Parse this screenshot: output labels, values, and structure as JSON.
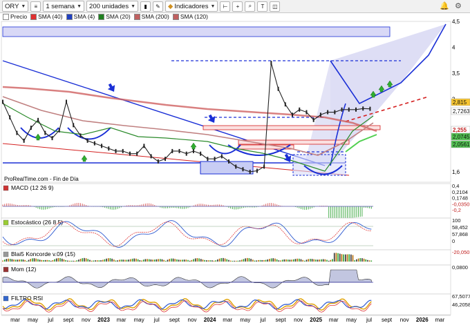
{
  "toolbar": {
    "symbol": "ORY",
    "period": "1 semana",
    "units": "200 unidades",
    "indicators": "Indicadores"
  },
  "legend": [
    {
      "label": "Precio",
      "color": "#ffffff"
    },
    {
      "label": "SMA (40)",
      "color": "#e03030"
    },
    {
      "label": "SMA (4)",
      "color": "#2040c0"
    },
    {
      "label": "SMA (20)",
      "color": "#208020"
    },
    {
      "label": "SMA (200)",
      "color": "#c06060"
    },
    {
      "label": "SMA (120)",
      "color": "#c06060"
    }
  ],
  "source_text": "ProRealTime.com - Fin de Día",
  "colors": {
    "price": "#222222",
    "trend": "#1a2fd6",
    "red_line": "#d42020",
    "sma20": "#2a8a2a",
    "sma200": "#cc4444",
    "macd_fill": "#4caf50",
    "stoch_blue": "#2b58d0",
    "stoch_red": "#e03a3a"
  },
  "chart_data": [
    {
      "type": "line",
      "panel": "price",
      "ylim": [
        1.4,
        4.5
      ],
      "y_ticks": [
        "4,5",
        "4",
        "3,5",
        "3",
        "1,6"
      ],
      "price_tags": [
        {
          "text": "2,815",
          "color": "#f7c531"
        },
        {
          "text": "2,7263",
          "color": "#ffffff"
        },
        {
          "text": "2,255",
          "color": "#ffffff"
        },
        {
          "text": "2,0745",
          "color": "#50c050"
        },
        {
          "text": "2,0561",
          "color": "#50c050"
        }
      ],
      "series": [
        {
          "name": "Precio",
          "x": [
            0,
            4,
            8,
            12,
            16,
            20,
            24,
            28,
            32,
            36,
            40,
            44,
            48,
            52,
            56,
            60,
            64,
            68,
            72,
            76,
            80,
            84,
            88,
            92,
            96,
            100,
            104,
            108,
            112,
            116,
            120,
            124,
            128,
            132,
            136,
            140,
            144,
            148,
            152,
            156,
            160,
            164,
            168,
            172,
            176,
            180,
            184,
            188,
            192,
            196,
            200,
            204,
            208
          ],
          "y": [
            2.95,
            2.65,
            2.35,
            2.2,
            2.45,
            2.6,
            2.35,
            2.25,
            2.4,
            2.95,
            2.5,
            2.3,
            2.2,
            2.15,
            2.1,
            2.05,
            2.0,
            2.0,
            1.95,
            1.95,
            2.1,
            1.9,
            1.8,
            1.85,
            2.0,
            2.0,
            1.95,
            2.0,
            1.95,
            1.85,
            1.85,
            1.9,
            1.8,
            1.7,
            1.65,
            1.6,
            1.62,
            1.7,
            3.7,
            3.2,
            2.9,
            2.7,
            2.8,
            2.75,
            2.6,
            2.7,
            2.75,
            2.75,
            2.8,
            2.8,
            2.8,
            2.82,
            2.815
          ]
        }
      ]
    },
    {
      "type": "area",
      "panel": "MACD (12 26 9)",
      "y_ticks": [
        "0,4",
        "0,2104",
        "0,1748",
        "-0,0350",
        "-0,2"
      ]
    },
    {
      "type": "line",
      "panel": "Estocástico (26 8 5)",
      "y_ticks": [
        "100",
        "58,452",
        "57,868",
        "0"
      ]
    },
    {
      "type": "area",
      "panel": "Blai5 Koncorde v.09 (15)",
      "y_ticks": [
        "-20,050"
      ]
    },
    {
      "type": "area",
      "panel": "Mom (12)",
      "y_ticks": [
        "0,0800"
      ]
    },
    {
      "type": "line",
      "panel": "FILTRO RSI",
      "y_ticks": [
        "67,5077",
        "46,2058"
      ]
    }
  ],
  "x_axis": [
    "mar",
    "may",
    "jul",
    "sept",
    "nov",
    "2023",
    "mar",
    "may",
    "jul",
    "sept",
    "nov",
    "2024",
    "mar",
    "may",
    "jul",
    "sept",
    "nov",
    "2025",
    "mar",
    "may",
    "jul",
    "sept",
    "nov",
    "2026",
    "mar"
  ],
  "panels": [
    {
      "label": "MACD (12 26 9)"
    },
    {
      "label": "Estocástico (26 8 5)"
    },
    {
      "label": "Blai5 Koncorde v.09 (15)"
    },
    {
      "label": "Mom (12)"
    },
    {
      "label": "FILTRO RSI"
    }
  ]
}
